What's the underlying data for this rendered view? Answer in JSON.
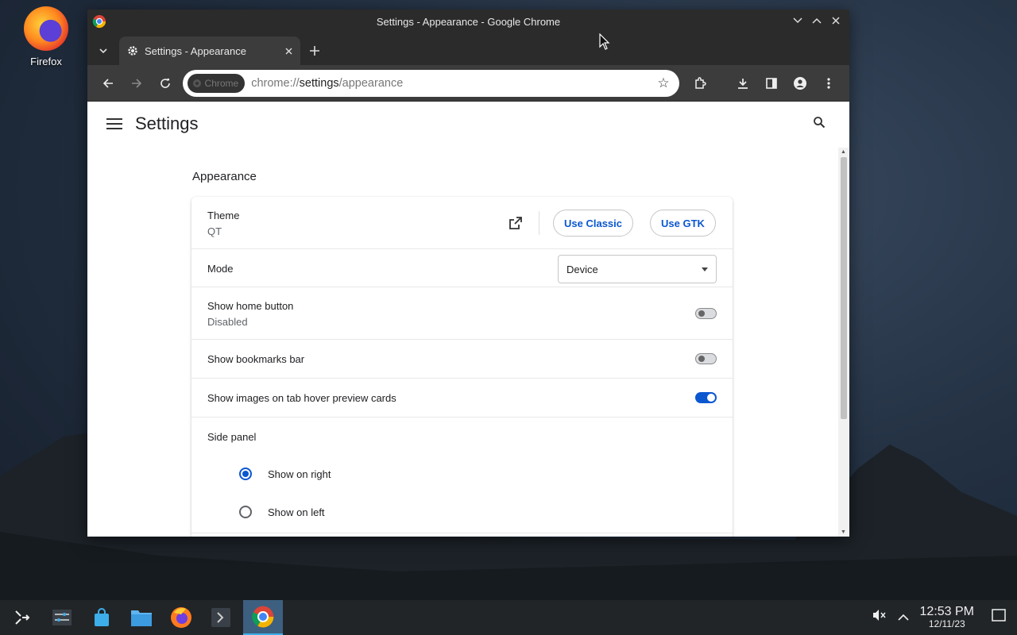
{
  "desktop": {
    "icons": [
      {
        "label": "Firefox",
        "icon": "firefox-icon"
      }
    ]
  },
  "window": {
    "title": "Settings - Appearance - Google Chrome"
  },
  "tab": {
    "title": "Settings - Appearance",
    "icon": "gear-icon"
  },
  "omnibox": {
    "chip": "Chrome",
    "url_prefix": "chrome://",
    "url_host": "settings",
    "url_path": "/appearance"
  },
  "settings": {
    "header_title": "Settings",
    "section_title": "Appearance",
    "theme": {
      "label": "Theme",
      "value": "QT",
      "use_classic": "Use Classic",
      "use_gtk": "Use GTK"
    },
    "mode": {
      "label": "Mode",
      "selected": "Device"
    },
    "home_button": {
      "label": "Show home button",
      "sub": "Disabled",
      "enabled": false
    },
    "bookmarks_bar": {
      "label": "Show bookmarks bar",
      "enabled": false
    },
    "hover_images": {
      "label": "Show images on tab hover preview cards",
      "enabled": true
    },
    "side_panel": {
      "label": "Side panel",
      "options": [
        "Show on right",
        "Show on left"
      ],
      "selected": "Show on right"
    }
  },
  "taskbar": {
    "time": "12:53 PM",
    "date": "12/11/23"
  },
  "colors": {
    "accent": "#0b57d0",
    "titlebar": "#2b2b2b",
    "taskbar": "#222528"
  }
}
